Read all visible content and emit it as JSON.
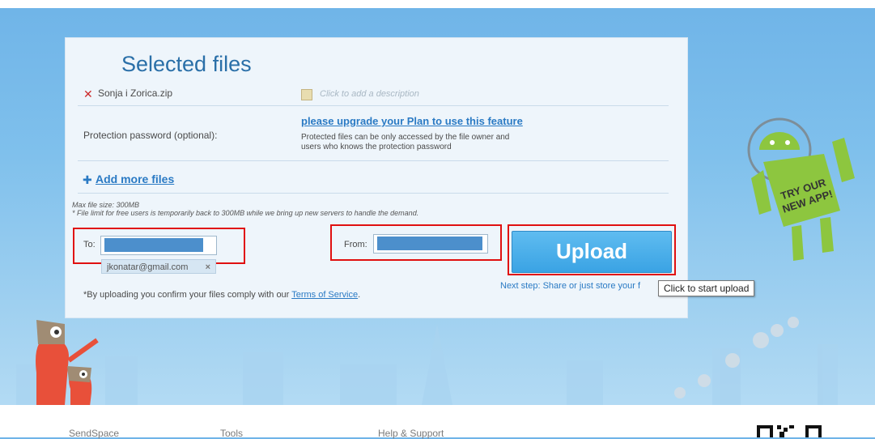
{
  "panel": {
    "title": "Selected files",
    "file": {
      "name": "Sonja i Zorica.zip",
      "description_placeholder": "Click to add a description"
    },
    "password": {
      "label": "Protection password (optional):",
      "upgrade_link": "please upgrade your Plan to use this feature",
      "note_line1": "Protected files can be only accessed by the file owner and",
      "note_line2": "users who knows the protection password"
    },
    "add_more": "Add more files",
    "limits": {
      "line1": "Max file size: 300MB",
      "line2": "* File limit for free users is temporarily back to 300MB while we bring up new servers to handle the demand."
    },
    "to_label": "To:",
    "to_email": "jkonatar@gmail.com",
    "chip_remove": "×",
    "from_label": "From:",
    "upload_label": "Upload",
    "next_step": "Next step: Share or just store your f",
    "tooltip": "Click to start upload",
    "terms_prefix": "*By uploading you confirm your files comply with our ",
    "terms_link": "Terms of Service",
    "terms_suffix": "."
  },
  "promo": {
    "line1": "TRY OUR",
    "line2": "NEW APP!"
  },
  "footer": {
    "col1": "SendSpace",
    "col2": "Tools",
    "col3": "Help & Support"
  },
  "colors": {
    "accent": "#2a6fa8",
    "highlight_red": "#e01010",
    "upload_blue": "#3aa3e4"
  }
}
